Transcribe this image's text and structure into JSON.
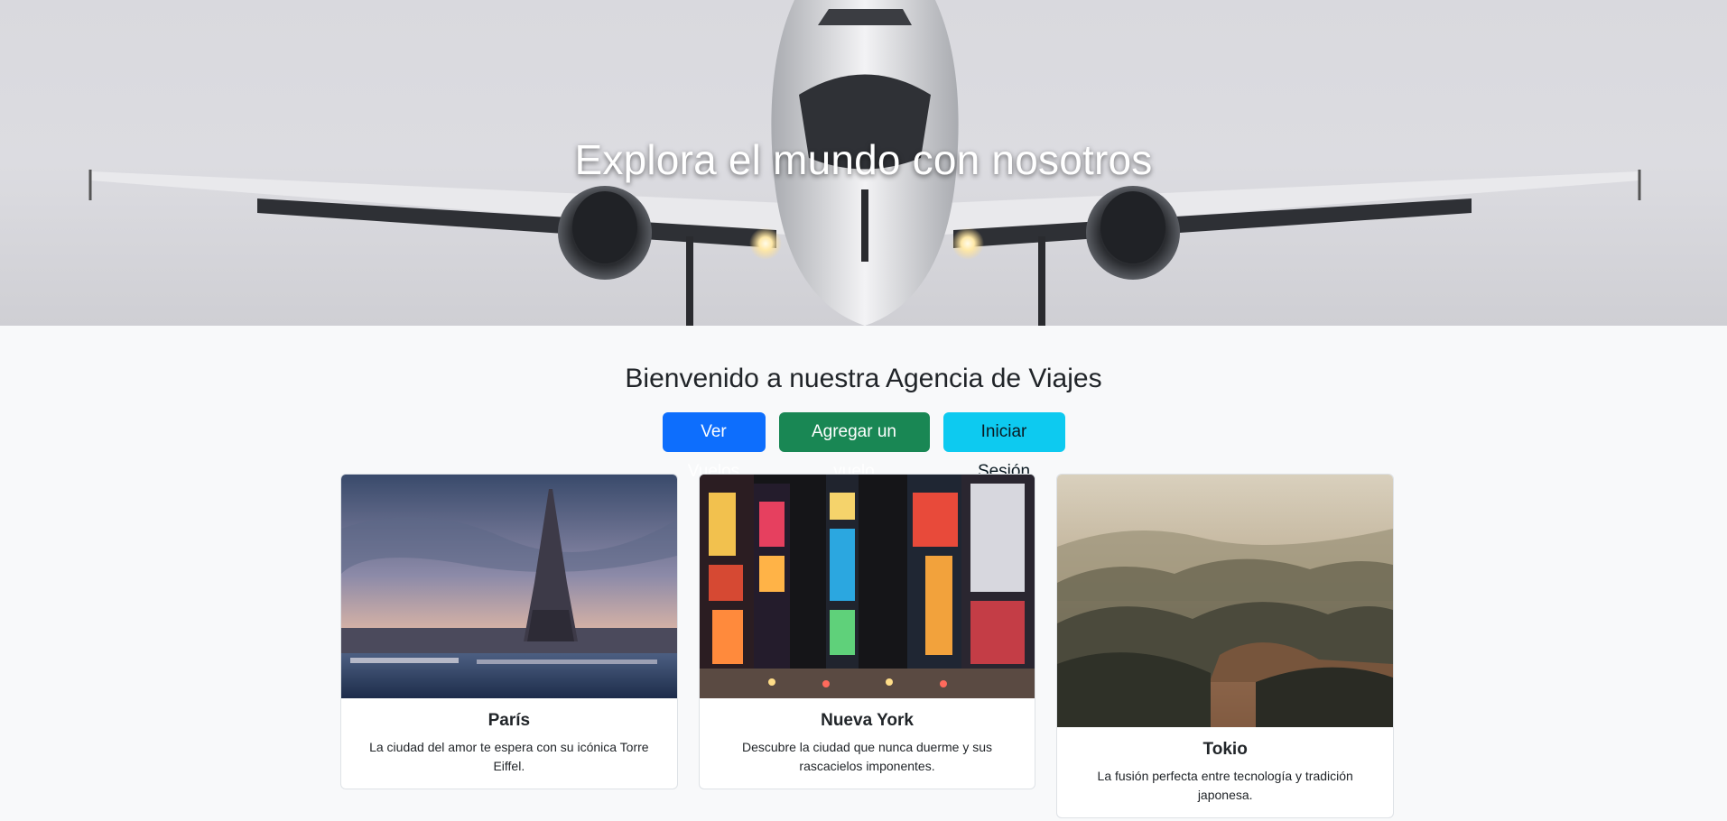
{
  "hero": {
    "title": "Explora el mundo con nosotros",
    "image": "airplane-landing-photo"
  },
  "welcome": {
    "heading": "Bienvenido a nuestra Agencia de Viajes"
  },
  "buttons": {
    "flights": "Ver Vuelos",
    "add_flight": "Agregar un vuelo",
    "login": "Iniciar Sesión"
  },
  "colors": {
    "primary": "#0d6efd",
    "success": "#198754",
    "info": "#0dcaf0",
    "background": "#f8f9fa"
  },
  "cards": [
    {
      "title": "París",
      "text": "La ciudad del amor te espera con su icónica Torre Eiffel.",
      "image": "eiffel-tower-photo"
    },
    {
      "title": "Nueva York",
      "text": "Descubre la ciudad que nunca duerme y sus rascacielos imponentes.",
      "image": "times-square-photo"
    },
    {
      "title": "Tokio",
      "text": "La fusión perfecta entre tecnología y tradición japonesa.",
      "image": "misty-mountains-photo"
    }
  ]
}
